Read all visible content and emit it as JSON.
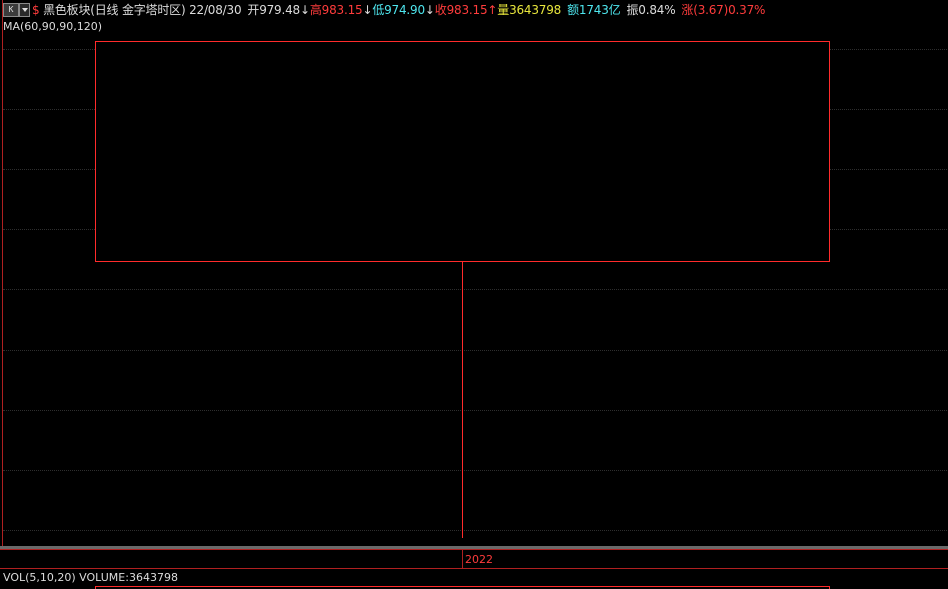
{
  "toolbar": {
    "k_label": "K",
    "dropdown_label": "▾"
  },
  "header": {
    "symbol_icon": "dollar-sign",
    "symbol_glyph": "$",
    "title": "黑色板块(日线 金字塔时区)",
    "date": "22/08/30",
    "open_label": "开",
    "open_value": "979.48",
    "open_arrow": "↓",
    "high_label": "高",
    "high_value": "983.15",
    "high_arrow": "↓",
    "low_label": "低",
    "low_value": "974.90",
    "low_arrow": "↓",
    "close_label": "收",
    "close_value": "983.15",
    "close_arrow": "↑",
    "volume_label": "量",
    "volume_value": "3643798",
    "amount_label": "额",
    "amount_value": "1743亿",
    "amplitude_label": "振",
    "amplitude_value": "0.84%",
    "change_label": "涨",
    "change_value": "(3.67)0.37%"
  },
  "ma_legend": "MA(60,90,90,120)",
  "date_axis": {
    "year_label": "2022"
  },
  "vol_legend": "VOL(5,10,20)  VOLUME:3643798",
  "colors": {
    "background": "#000000",
    "up": "#ff2b2b",
    "down": "#4ee6ee",
    "text": "#dcdcdc",
    "volume": "#e8e63c"
  }
}
